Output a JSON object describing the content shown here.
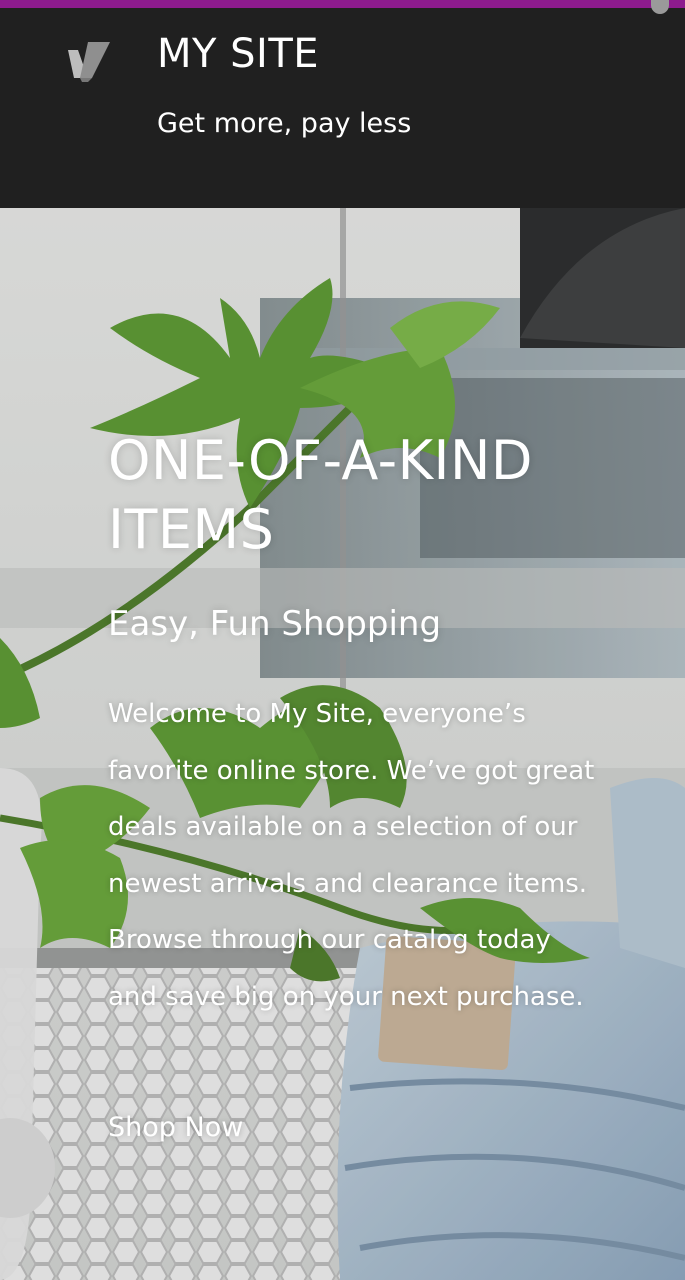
{
  "header": {
    "site_title": "MY SITE",
    "tagline": "Get more, pay less",
    "logo_icon": "v-logo-icon"
  },
  "hero": {
    "heading": "ONE-OF-A-KIND ITEMS",
    "subheading": "Easy, Fun Shopping",
    "body": "Welcome to My Site, everyone’s favorite online store. We’ve got great deals available on a selection of our newest arrivals and clearance items. Browse through our catalog today and save big on your next purchase.",
    "cta_label": "Shop Now"
  },
  "colors": {
    "accent": "#8e1b8e",
    "header_bg": "#202020",
    "text": "#ffffff"
  }
}
